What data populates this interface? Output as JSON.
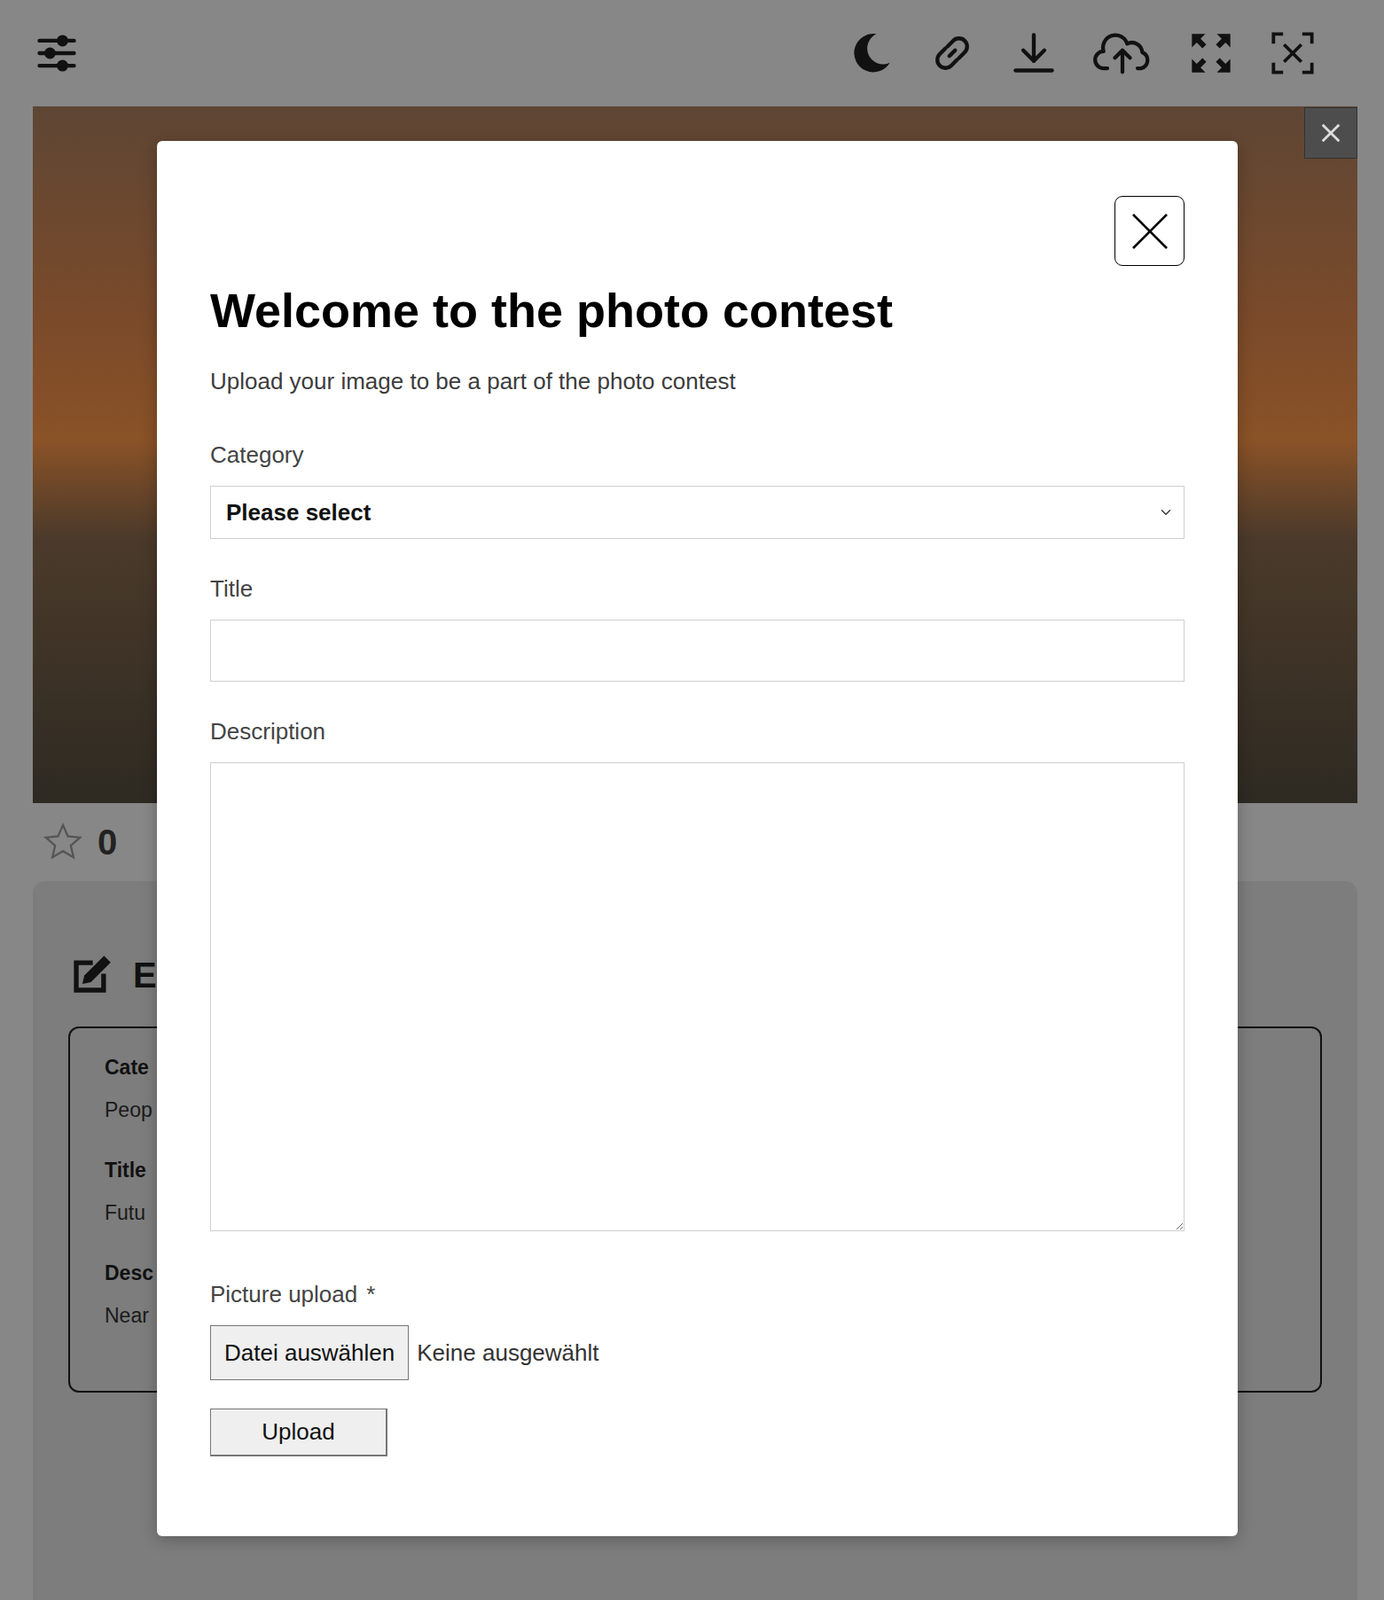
{
  "rating": {
    "stars": 0,
    "count": "0"
  },
  "entry": {
    "heading": "E",
    "fields": [
      {
        "label": "Cate",
        "value": "Peop"
      },
      {
        "label": "Title",
        "value": "Futu"
      },
      {
        "label": "Desc",
        "value": "Near"
      }
    ]
  },
  "modal": {
    "title": "Welcome to the photo contest",
    "subtitle": "Upload your image to be a part of the photo contest",
    "fields": [
      {
        "kind": "select",
        "label": "Category",
        "value": "Please select"
      },
      {
        "kind": "text",
        "label": "Title",
        "value": ""
      },
      {
        "kind": "textarea",
        "label": "Description",
        "value": ""
      },
      {
        "kind": "file",
        "label": "Picture upload",
        "required": true,
        "required_mark": "*",
        "button": "Datei auswählen",
        "status": "Keine ausgewählt"
      }
    ],
    "submit": "Upload"
  }
}
